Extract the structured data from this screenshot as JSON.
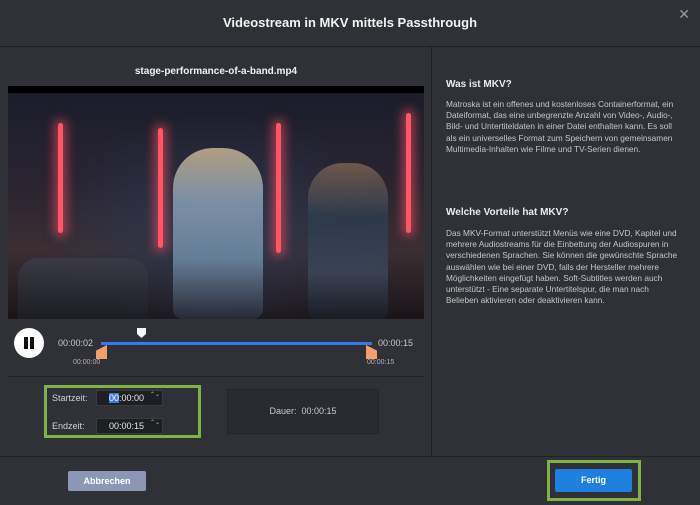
{
  "dialog": {
    "title": "Videostream in MKV mittels Passthrough",
    "close_glyph": "✕"
  },
  "player": {
    "filename": "stage-performance-of-a-band.mp4",
    "current_time": "00:00:02",
    "end_time": "00:00:15",
    "range_start_label": "00:00:00",
    "range_end_label": "00:00:15",
    "playhead_fraction": 0.13,
    "state": "playing"
  },
  "trim": {
    "start_label": "Startzeit:",
    "start_value_selected": "00",
    "start_value_rest": ":00:00",
    "end_label": "Endzeit:",
    "end_value": "00:00:15",
    "spin_glyph": "⌃⌄",
    "duration_label": "Dauer:",
    "duration_value": "00:00:15"
  },
  "info": {
    "heading1": "Was ist MKV?",
    "text1": "Matroska ist ein offenes und kostenloses Containerformat, ein Dateiformat, das eine unbegrenzte Anzahl von Video-, Audio-, Bild- und Untertiteldaten in einer Datei enthalten kann. Es soll als ein universelles Format zum Speichern von gemeinsamen Multimedia-Inhalten wie Filme und TV-Serien dienen.",
    "heading2": "Welche Vorteile hat MKV?",
    "text2": "Das MKV-Format unterstützt Menüs wie eine DVD, Kapitel und mehrere Audiostreams für die Einbettung der Audiospuren in verschiedenen Sprachen. Sie können die gewünschte Sprache auswählen wie bei einer DVD, falls der Hersteller mehrere Möglichkeiten eingefügt haben. Soft-Subtitles werden auch unterstützt - Eine separate Untertitelspur, die man nach Belieben aktivieren oder deaktivieren kann."
  },
  "footer": {
    "cancel_label": "Abbrechen",
    "done_label": "Fertig"
  },
  "colors": {
    "accent_blue": "#1e7fe0",
    "highlight_green": "#7cb342",
    "trim_handle_orange": "#f2a06a"
  }
}
